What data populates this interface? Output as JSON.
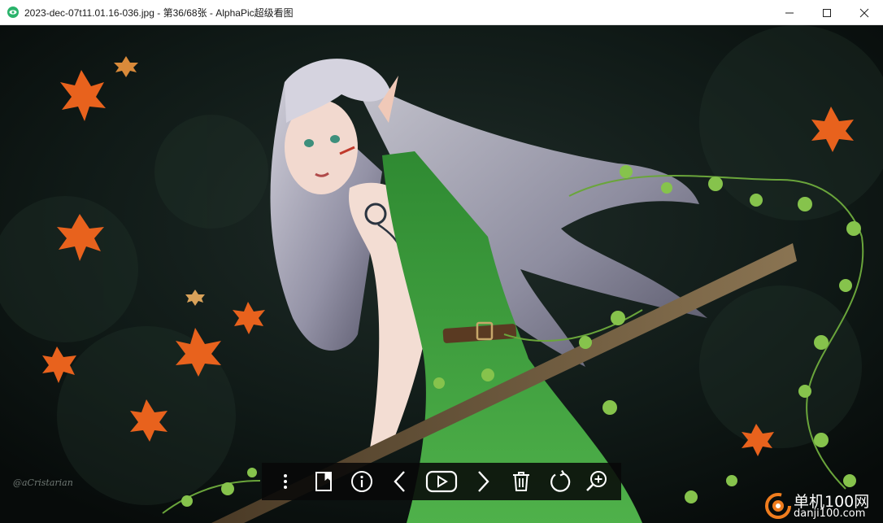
{
  "window": {
    "title": "2023-dec-07t11.01.16-036.jpg - 第36/68张 - AlphaPic超级看图",
    "app_icon": "alphapic-app-icon",
    "controls": [
      "minimize-icon",
      "maximize-icon",
      "close-icon"
    ]
  },
  "image": {
    "description_icon": "fantasy-elf-girl-artwork",
    "artist_signature": "@aCristarian"
  },
  "toolbar": {
    "buttons": [
      {
        "icon": "more-vertical-icon"
      },
      {
        "icon": "bookmark-icon"
      },
      {
        "icon": "info-icon"
      },
      {
        "icon": "previous-icon"
      },
      {
        "icon": "slideshow-play-icon"
      },
      {
        "icon": "next-icon"
      },
      {
        "icon": "delete-icon"
      },
      {
        "icon": "rotate-icon"
      },
      {
        "icon": "zoom-in-icon"
      }
    ]
  },
  "site_watermark": {
    "name": "单机100网",
    "url": "danji100.com",
    "accent": "#f07d1e"
  },
  "colors": {
    "titlebar_bg": "#ffffff",
    "toolbar_bg": "#080808",
    "leaf_orange": "#e8621d",
    "dress_green": "#3f9a3c"
  }
}
